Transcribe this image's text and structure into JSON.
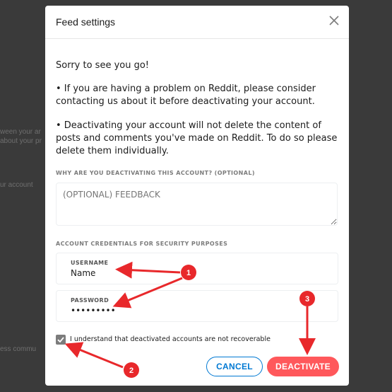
{
  "modal": {
    "title": "Feed settings",
    "intro": "Sorry to see you go!",
    "bullet1": "•  If you are having a problem on Reddit, please consider contacting us about it before deactivating your account.",
    "bullet2": "•  Deactivating your account will not delete the content of posts and comments you've made on Reddit. To do so please delete them individually.",
    "reason_label": "WHY ARE YOU DEACTIVATING THIS ACCOUNT? (OPTIONAL)",
    "feedback_placeholder": "(OPTIONAL) FEEDBACK",
    "credentials_label": "ACCOUNT CREDENTIALS FOR SECURITY PURPOSES",
    "username_label": "USERNAME",
    "username_value": "Name",
    "password_label": "PASSWORD",
    "password_value": "•••••••••",
    "checkbox_label": "I understand that deactivated accounts are not recoverable",
    "checkbox_checked": true,
    "cancel_label": "CANCEL",
    "deactivate_label": "DEACTIVATE"
  },
  "callouts": [
    "1",
    "2",
    "3"
  ],
  "colors": {
    "accent_blue": "#0079d3",
    "deactivate_red": "#ff585b",
    "annotation_red": "#e8282b",
    "backdrop": "#3a3a3a"
  }
}
